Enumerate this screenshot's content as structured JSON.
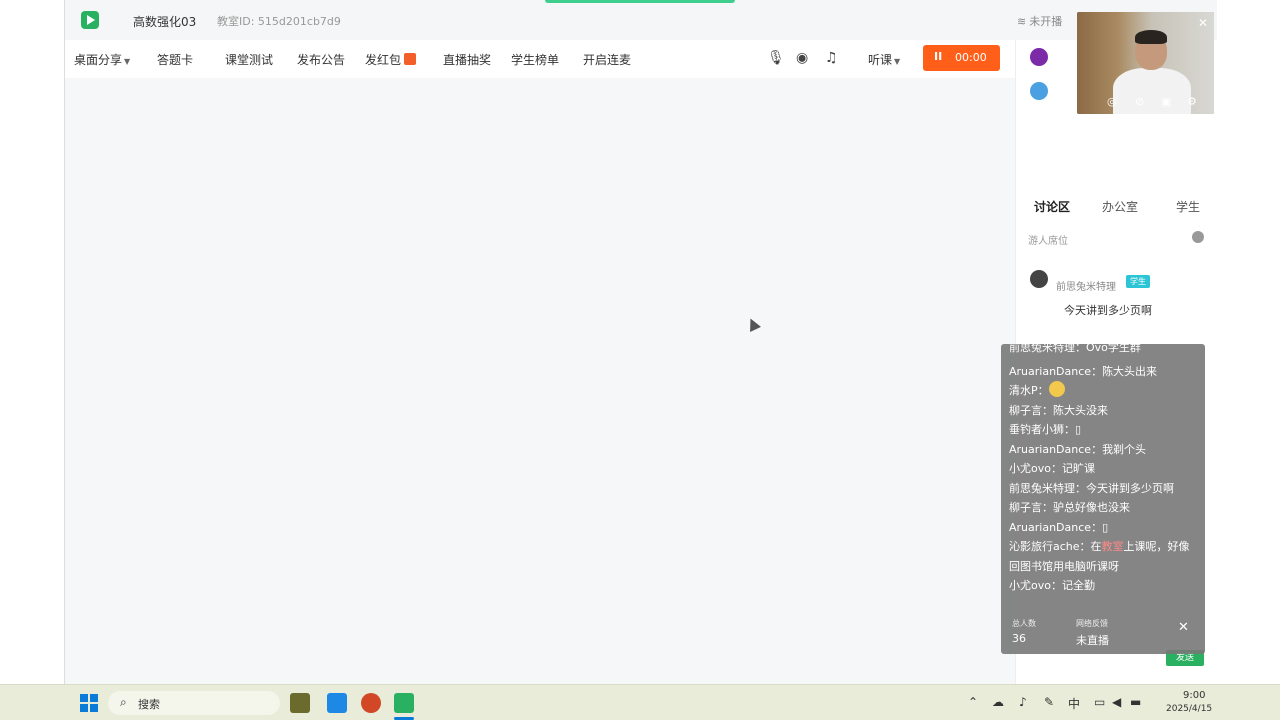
{
  "titlebar": {
    "course_name": "高数强化03",
    "room_id": "教室ID: 515d201cb7d9",
    "network_status": "未开播"
  },
  "toolbar": {
    "items": [
      {
        "label": "桌面分享",
        "has_caret": true
      },
      {
        "label": "答题卡"
      },
      {
        "label": "课堂测试"
      },
      {
        "label": "发布公告"
      },
      {
        "label": "发红包"
      },
      {
        "label": "直播抽奖"
      },
      {
        "label": "学生榜单"
      },
      {
        "label": "开启连麦"
      }
    ],
    "listen_label": "听课",
    "live_button": {
      "time": "00:00",
      "color": "#ff5f19"
    }
  },
  "sidebar": {
    "tabs": [
      "讨论区",
      "办公室",
      "学生"
    ],
    "active_tab": "讨论区",
    "sort_label": "游人席位",
    "message": {
      "user": "前思兔米特理",
      "tag": "学生",
      "text": "今天讲到多少页啊"
    },
    "send_label": "发送"
  },
  "danmaku": {
    "lines": [
      {
        "user": "前思兔米特理",
        "text": "Ovo学生群"
      },
      {
        "user": "AruarianDance",
        "text": "陈大头出来"
      },
      {
        "user": "清水P",
        "text": "",
        "emoji": true
      },
      {
        "user": "柳子言",
        "text": "陈大头没来"
      },
      {
        "user": "垂钓者小狮",
        "text": "▯"
      },
      {
        "user": "AruarianDance",
        "text": "我剃个头"
      },
      {
        "user": "小尤ovo",
        "text": "记旷课"
      },
      {
        "user": "前思兔米特理",
        "text": "今天讲到多少页啊"
      },
      {
        "user": "柳子言",
        "text": "驴总好像也没来"
      },
      {
        "user": "AruarianDance",
        "text": "▯"
      },
      {
        "user": "沁影旅行ache",
        "pre": "在",
        "highlight": "教室",
        "post": "上课呢，好像回图书馆用电脑听课呀"
      },
      {
        "user": "小尤ovo",
        "text": "记全勤"
      }
    ],
    "footer": {
      "total_label": "总人数",
      "total_value": "36",
      "feedback_label": "网络反馈",
      "status_value": "未直播"
    }
  },
  "taskbar": {
    "search_placeholder": "搜索",
    "ime": "中",
    "time": "9:00",
    "date": "2025/4/15"
  },
  "colors": {
    "accent_green": "#2ab061",
    "live_orange": "#ff5f19",
    "tag_cyan": "#2cc5d6",
    "windows_blue": "#0a7bd6"
  }
}
